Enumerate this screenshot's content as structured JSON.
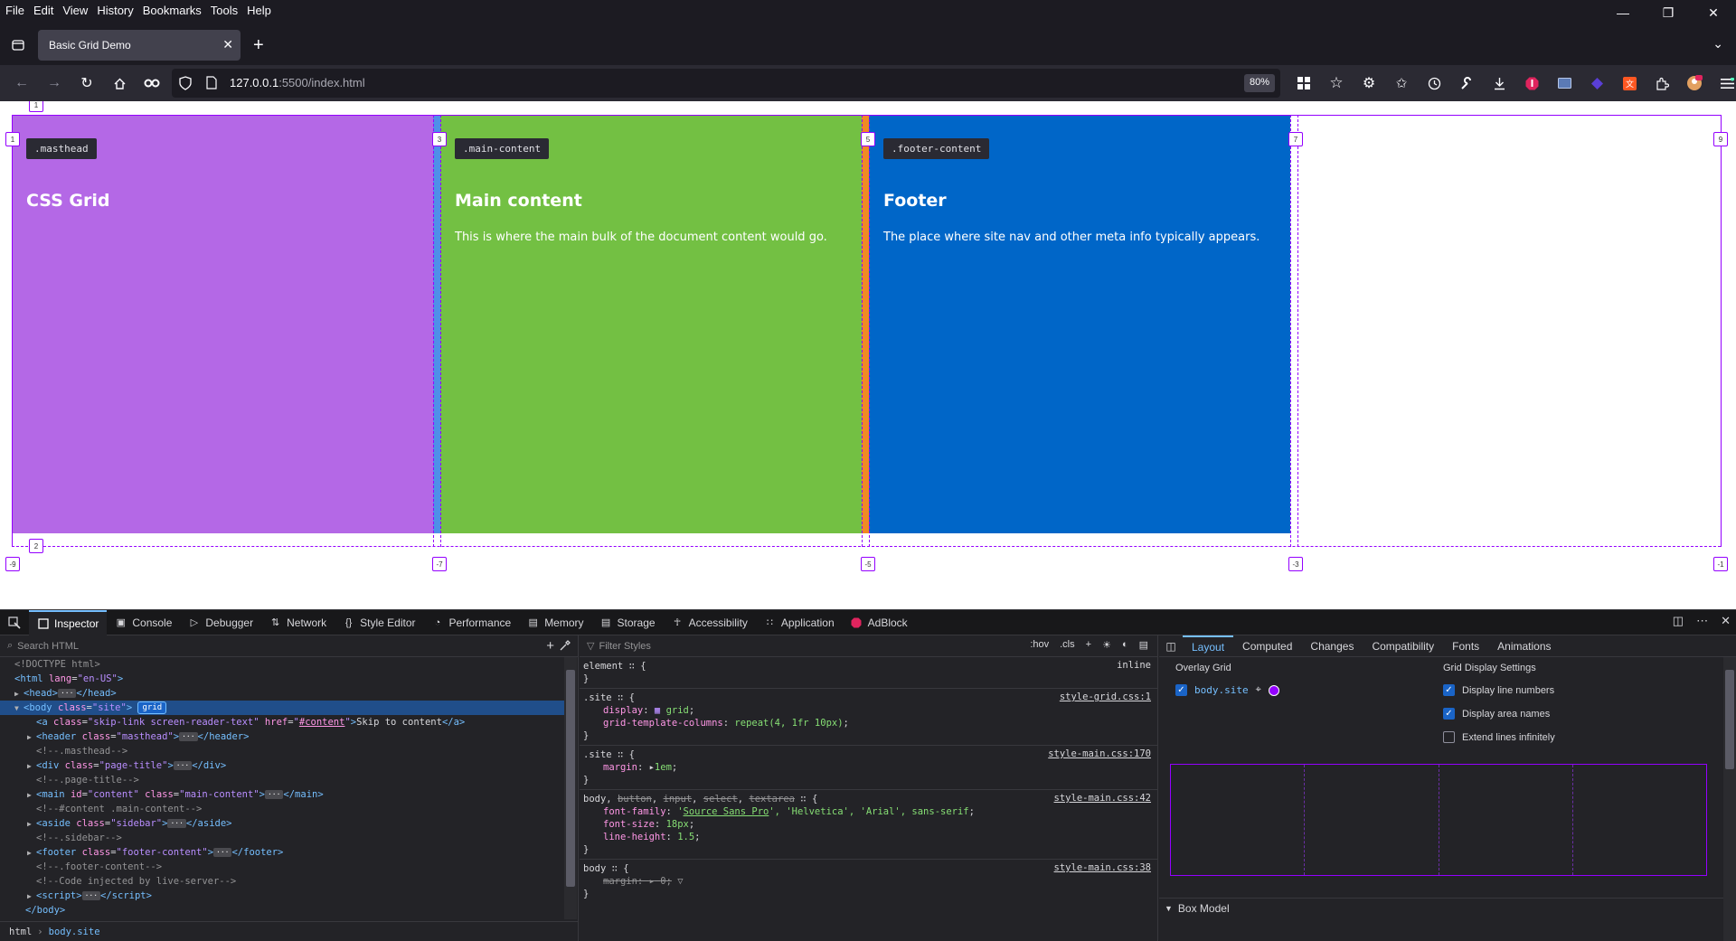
{
  "menu": [
    "File",
    "Edit",
    "View",
    "History",
    "Bookmarks",
    "Tools",
    "Help"
  ],
  "tab": {
    "title": "Basic Grid Demo"
  },
  "url": {
    "host": "127.0.0.1",
    "rest": ":5500/index.html",
    "zoom": "80%"
  },
  "page": {
    "masthead": {
      "badge": ".masthead",
      "heading": "CSS Grid"
    },
    "main": {
      "badge": ".main-content",
      "heading": "Main content",
      "text": "This is where the main bulk of the document content would go."
    },
    "footer": {
      "badge": ".footer-content",
      "heading": "Footer",
      "text": "The place where site nav and other meta info typically appears."
    },
    "line_numbers": {
      "top_col": [
        "1",
        "3",
        "5",
        "7",
        "9"
      ],
      "bottom_col": [
        "-9",
        "-7",
        "-5",
        "-3",
        "-1"
      ],
      "row_top": "1",
      "row_bottom": "2"
    },
    "colors": {
      "masthead": "#b468e6",
      "main": "#73c043",
      "footer": "#0066c8",
      "overlay": "#9400ff"
    }
  },
  "devtools": {
    "tabs": [
      "Inspector",
      "Console",
      "Debugger",
      "Network",
      "Style Editor",
      "Performance",
      "Memory",
      "Storage",
      "Accessibility",
      "Application",
      "AdBlock"
    ],
    "search_placeholder": "Search HTML",
    "filter_placeholder": "Filter Styles",
    "hov": ":hov",
    "cls": ".cls",
    "tree": {
      "doctype": "<!DOCTYPE html>",
      "html_lang": "en-US",
      "body_class": "site",
      "body_badge": "grid",
      "skip_class": "skip-link screen-reader-text",
      "skip_href": "#content",
      "skip_text": "Skip to content",
      "masthead_class": "masthead",
      "c1": "<!--.masthead-->",
      "page_title_class": "page-title",
      "c2": "<!--.page-title-->",
      "main_id": "content",
      "main_class": "main-content",
      "c3": "<!--#content .main-content-->",
      "aside_class": "sidebar",
      "c4": "<!--.sidebar-->",
      "footer_class": "footer-content",
      "c5": "<!--.footer-content-->",
      "c6": "<!--Code injected by live-server-->"
    },
    "breadcrumbs": [
      "html",
      "body.site"
    ],
    "rules": {
      "element": {
        "selector": "element",
        "source": "inline"
      },
      "site_grid": {
        "selector": ".site",
        "source": "style-grid.css:1",
        "display": "grid",
        "columns": "repeat(4, 1fr 10px)"
      },
      "site_main": {
        "selector": ".site",
        "source": "style-main.css:170",
        "margin": "1em"
      },
      "body_group": {
        "source": "style-main.css:42",
        "font_family": "'Helvetica', 'Arial', sans-serif",
        "font_link": "Source Sans Pro",
        "font_size": "18px",
        "line_height": "1.5"
      },
      "body": {
        "selector": "body",
        "source": "style-main.css:38",
        "margin": "0"
      }
    },
    "layout": {
      "tabs": [
        "Layout",
        "Computed",
        "Changes",
        "Compatibility",
        "Fonts",
        "Animations"
      ],
      "overlay_grid": "Overlay Grid",
      "grid_item": "body.site",
      "grid_settings": "Grid Display Settings",
      "settings": [
        {
          "label": "Display line numbers",
          "checked": true
        },
        {
          "label": "Display area names",
          "checked": true
        },
        {
          "label": "Extend lines infinitely",
          "checked": false
        }
      ],
      "box_model": "Box Model"
    }
  }
}
